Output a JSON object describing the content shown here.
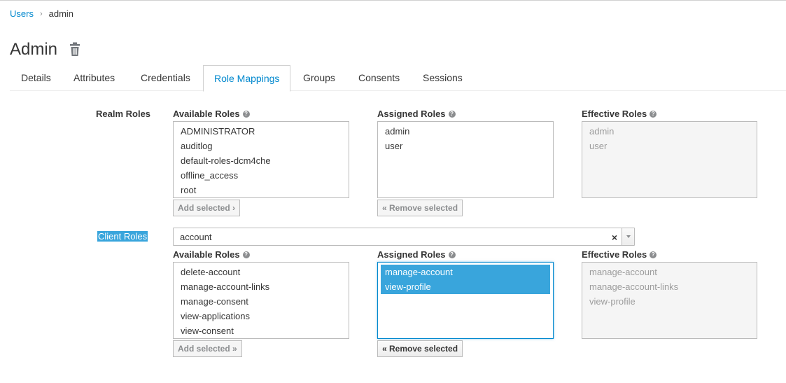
{
  "breadcrumb": {
    "parent": "Users",
    "separator": "›",
    "current": "admin"
  },
  "page": {
    "title": "Admin"
  },
  "tabs": [
    {
      "label": "Details"
    },
    {
      "label": "Attributes"
    },
    {
      "label": "Credentials"
    },
    {
      "label": "Role Mappings",
      "active": true
    },
    {
      "label": "Groups"
    },
    {
      "label": "Consents"
    },
    {
      "label": "Sessions"
    }
  ],
  "realm": {
    "label": "Realm Roles",
    "available_header": "Available Roles",
    "assigned_header": "Assigned Roles",
    "effective_header": "Effective Roles",
    "available": [
      "ADMINISTRATOR",
      "auditlog",
      "default-roles-dcm4che",
      "offline_access",
      "root"
    ],
    "assigned": [
      "admin",
      "user"
    ],
    "effective": [
      "admin",
      "user"
    ],
    "add_button": "Add selected ›",
    "remove_button": "« Remove selected"
  },
  "client": {
    "label": "Client Roles",
    "selected_client": "account",
    "clear_symbol": "×",
    "available_header": "Available Roles",
    "assigned_header": "Assigned Roles",
    "effective_header": "Effective Roles",
    "available": [
      "delete-account",
      "manage-account-links",
      "manage-consent",
      "view-applications",
      "view-consent"
    ],
    "assigned": [
      "manage-account",
      "view-profile"
    ],
    "assigned_selected": [
      "manage-account",
      "view-profile"
    ],
    "effective": [
      "manage-account",
      "manage-account-links",
      "view-profile"
    ],
    "add_button": "Add selected »",
    "remove_button": "« Remove selected"
  },
  "help_symbol": "?",
  "colors": {
    "accent": "#0088ce",
    "selection": "#39a5dc"
  }
}
